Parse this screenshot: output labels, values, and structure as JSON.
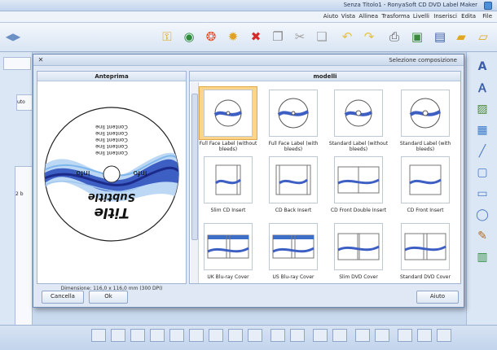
{
  "window": {
    "title": "Senza Titolo1 - RonyaSoft CD DVD Label Maker"
  },
  "menu": [
    "Aiuto",
    "Vista",
    "Allinea",
    "Trasforma",
    "Livelli",
    "Inserisci",
    "Edita",
    "File"
  ],
  "dialog": {
    "title": "Selezione composizione",
    "preview_header": "Anteprima",
    "models_header": "modelli",
    "dimensions": "Dimensione: 116,0 x 116,0 mm (300 DPI)",
    "help_button": "Aiuto",
    "ok_button": "Ok",
    "cancel_button": "Cancella",
    "preview": {
      "title": "Title",
      "subtitle": "Subtitle",
      "info_left": "Info",
      "info_right": "Info",
      "content_line": "Content line"
    }
  },
  "models": [
    {
      "label": "Standard Label (with bleeds)"
    },
    {
      "label": "Standard Label (without bleeds)"
    },
    {
      "label": "Full Face Label (with bleeds)"
    },
    {
      "label": "Full Face Label (without bleeds)",
      "selected": true
    },
    {
      "label": "CD Front Insert"
    },
    {
      "label": "CD Front Double Insert"
    },
    {
      "label": "CD Back Insert"
    },
    {
      "label": "Slim CD Insert"
    },
    {
      "label": "Standard DVD Cover"
    },
    {
      "label": "Slim DVD Cover"
    },
    {
      "label": "US Blu-ray Cover"
    },
    {
      "label": "UK Blu-ray Cover"
    }
  ],
  "left_panel": {
    "button1": "uto",
    "text1": "2 b"
  },
  "colors": {
    "accent": "#fcd58a",
    "frame": "#6d8bb4",
    "wave_dark": "#1c2a8a",
    "wave_light": "#7fb6ec"
  }
}
